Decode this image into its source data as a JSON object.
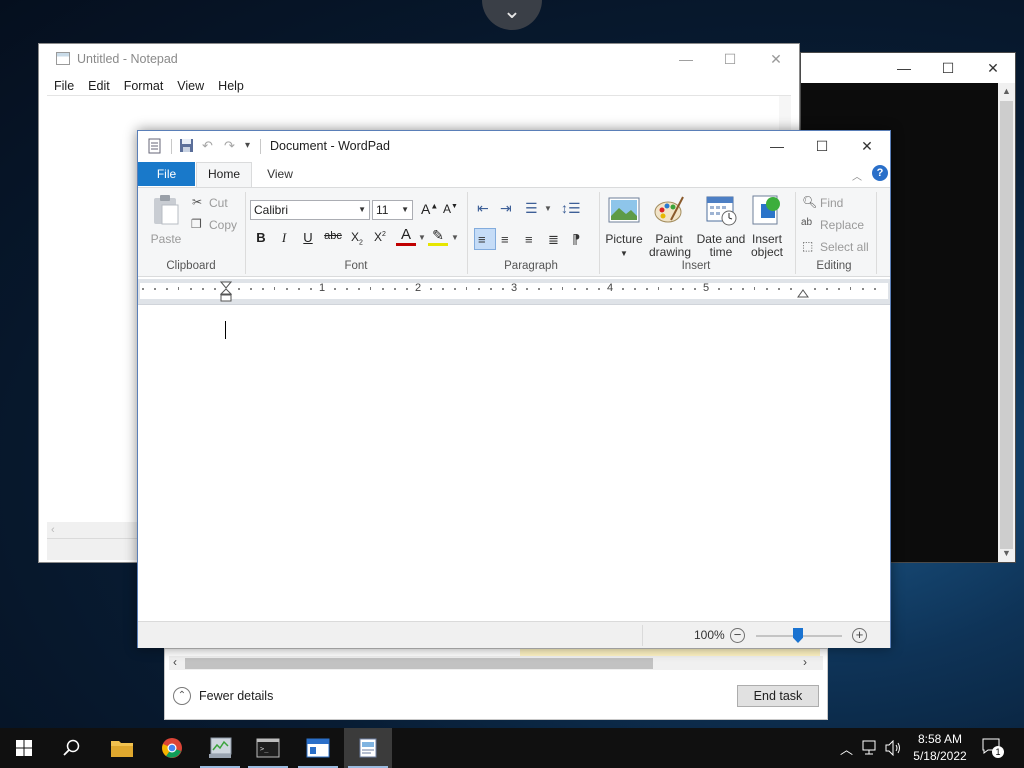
{
  "notepad": {
    "title": "Untitled - Notepad",
    "menu": [
      "File",
      "Edit",
      "Format",
      "View",
      "Help"
    ],
    "caption": {
      "minimize": "—",
      "maximize": "☐",
      "close": "✕"
    }
  },
  "console": {
    "caption": {
      "minimize": "—",
      "maximize": "☐",
      "close": "✕"
    }
  },
  "wordpad": {
    "title": "Document - WordPad",
    "tabs": {
      "file": "File",
      "home": "Home",
      "view": "View"
    },
    "caption": {
      "minimize": "—",
      "maximize": "☐",
      "close": "✕"
    },
    "clipboard": {
      "group": "Clipboard",
      "paste": "Paste",
      "cut": "Cut",
      "copy": "Copy"
    },
    "font": {
      "group": "Font",
      "family": "Calibri",
      "size": "11"
    },
    "paragraph": {
      "group": "Paragraph"
    },
    "insert": {
      "group": "Insert",
      "picture": "Picture",
      "paint_drawing": [
        "Paint",
        "drawing"
      ],
      "date_time": [
        "Date and",
        "time"
      ],
      "insert_object": [
        "Insert",
        "object"
      ]
    },
    "editing": {
      "group": "Editing",
      "find": "Find",
      "replace": "Replace",
      "select_all": "Select all"
    },
    "ruler_numbers": [
      "1",
      "2",
      "3",
      "4",
      "5"
    ],
    "status": {
      "zoom": "100%"
    }
  },
  "taskmgr": {
    "fewer_details": "Fewer details",
    "end_task": "End task"
  },
  "taskbar": {
    "time": "8:58 AM",
    "date": "5/18/2022",
    "notification_count": "1"
  }
}
